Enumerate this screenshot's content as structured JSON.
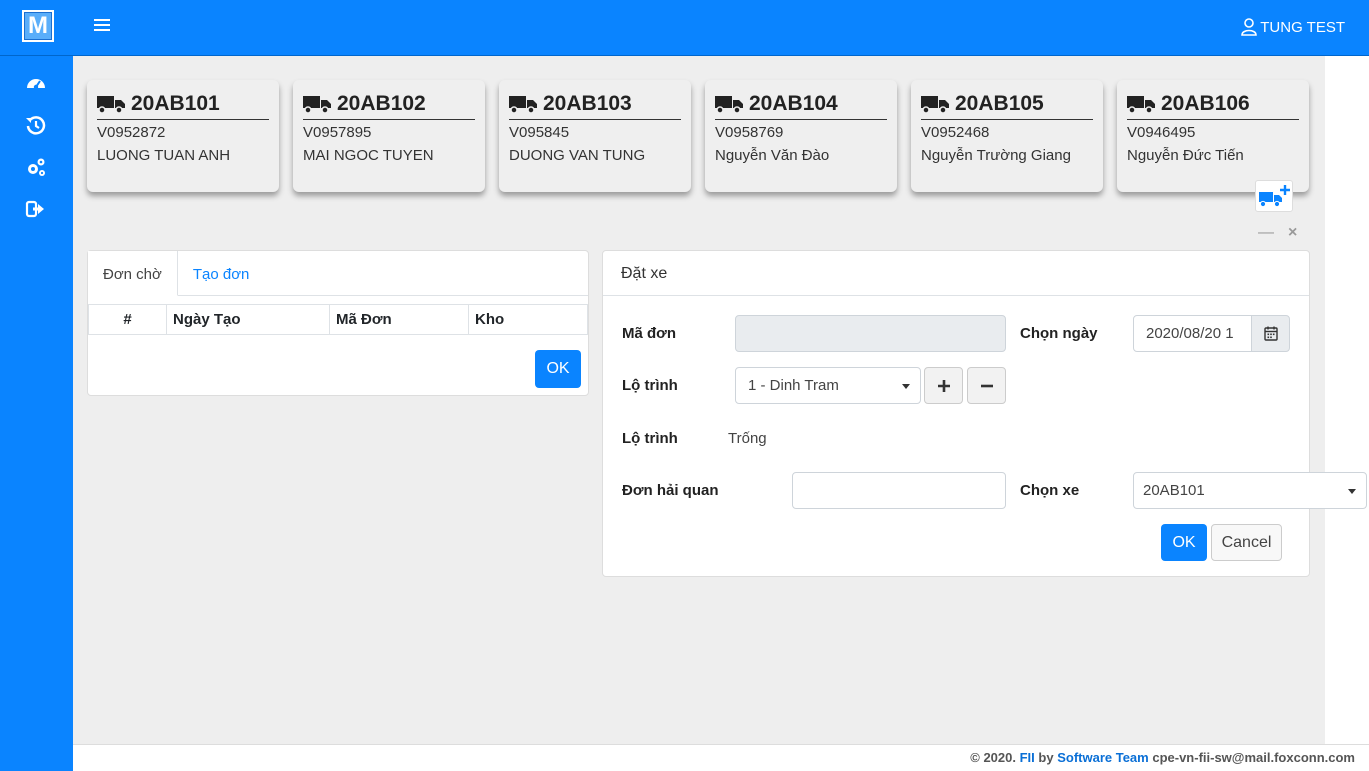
{
  "app": {
    "logo_text": "M",
    "user_name": "TUNG TEST"
  },
  "sidebar": {
    "items": [
      {
        "icon": "dashboard-icon"
      },
      {
        "icon": "history-icon"
      },
      {
        "icon": "settings-icon"
      },
      {
        "icon": "logout-icon"
      }
    ]
  },
  "vehicles": [
    {
      "plate": "20AB101",
      "code": "V0952872",
      "driver": "LUONG TUAN ANH"
    },
    {
      "plate": "20AB102",
      "code": "V0957895",
      "driver": "MAI NGOC TUYEN"
    },
    {
      "plate": "20AB103",
      "code": "V095845",
      "driver": "DUONG VAN TUNG"
    },
    {
      "plate": "20AB104",
      "code": "V0958769",
      "driver": "Nguyễn Văn Đào"
    },
    {
      "plate": "20AB105",
      "code": "V0952468",
      "driver": "Nguyễn Trường Giang"
    },
    {
      "plate": "20AB106",
      "code": "V0946495",
      "driver": "Nguyễn Đức Tiến"
    }
  ],
  "orders_panel": {
    "tabs": [
      "Đơn chờ",
      "Tạo đơn"
    ],
    "columns": [
      "#",
      "Ngày Tạo",
      "Mã Đơn",
      "Kho"
    ],
    "ok_label": "OK"
  },
  "booking": {
    "title": "Đặt xe",
    "ma_don_label": "Mã đơn",
    "ma_don_value": "",
    "chon_ngay_label": "Chọn ngày",
    "chon_ngay_value": "2020/08/20 1",
    "lo_trinh_label": "Lộ trình",
    "lo_trinh_selected": "1 - Dinh Tram",
    "lo_trinh2_label": "Lộ trình",
    "lo_trinh2_value": "Trống",
    "don_hai_quan_label": "Đơn hải quan",
    "don_hai_quan_value": "",
    "chon_xe_label": "Chọn xe",
    "chon_xe_selected": "20AB101",
    "ok_label": "OK",
    "cancel_label": "Cancel"
  },
  "footer": {
    "prefix": "© 2020.",
    "org": "FII",
    "by": "by",
    "team": "Software Team",
    "email": "cpe-vn-fii-sw@mail.foxconn.com"
  },
  "colors": {
    "primary": "#0a84ff",
    "background": "#eeeeee"
  }
}
